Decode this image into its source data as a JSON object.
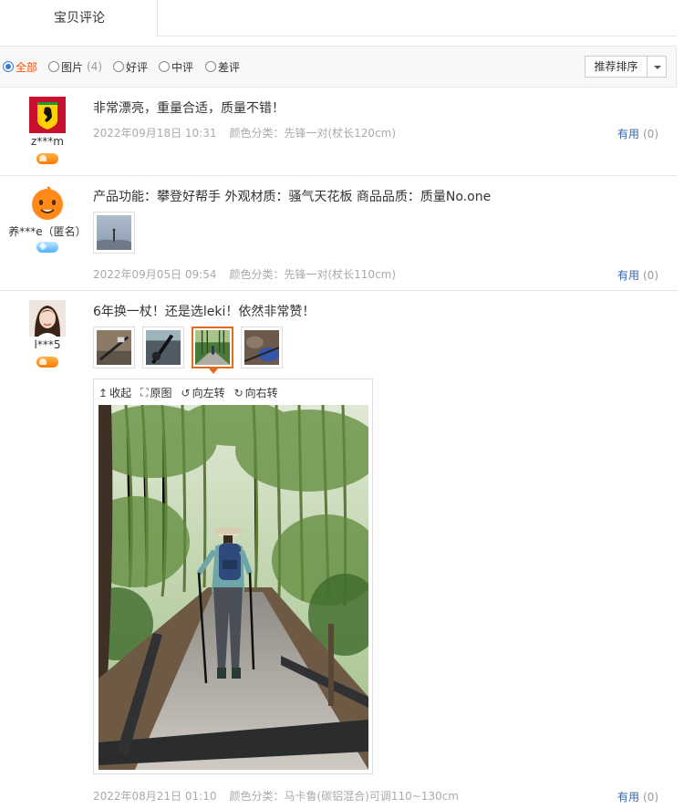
{
  "tabs": [
    {
      "label": "宝贝评论"
    }
  ],
  "filters": {
    "options": [
      {
        "label": "全部",
        "count": "",
        "checked": true
      },
      {
        "label": "图片",
        "count": "(4)",
        "checked": false
      },
      {
        "label": "好评",
        "count": "",
        "checked": false
      },
      {
        "label": "中评",
        "count": "",
        "checked": false
      },
      {
        "label": "差评",
        "count": "",
        "checked": false
      }
    ],
    "sort_label": "推荐排序"
  },
  "reviews": [
    {
      "username": "z***m",
      "content": "非常漂亮，重量合适，质量不错！",
      "date": "2022年09月18日 10:31",
      "sku": "颜色分类：先锋一对(杖长120cm)",
      "useful_label": "有用",
      "useful_count": "(0)",
      "avatar": "ferrari-logo-avatar",
      "badge": "heart-level-badge"
    },
    {
      "username": "养***e（匿名）",
      "content": "产品功能：攀登好帮手 外观材质：骚气天花板 商品品质：质量No.one",
      "date": "2022年09月05日 09:54",
      "sku": "颜色分类：先锋一对(杖长110cm)",
      "useful_label": "有用",
      "useful_count": "(0)",
      "avatar": "orange-mascot-avatar",
      "badge": "diamond-level-badge"
    },
    {
      "username": "l***5",
      "content": "6年换一杖！还是选leki！依然非常赞！",
      "date": "2022年08月21日 01:10",
      "sku": "颜色分类：马卡鲁(碳铝混合)可调110~130cm",
      "useful_label": "有用",
      "useful_count": "(0)",
      "avatar": "woman-portrait-avatar",
      "badge": "heart-level-badge",
      "viewer_tools": [
        "收起",
        "原图",
        "向左转",
        "向右转"
      ]
    }
  ],
  "colors": {
    "accent": "#ff5000",
    "link": "#3366aa",
    "active_thumb": "#e06c1c"
  }
}
